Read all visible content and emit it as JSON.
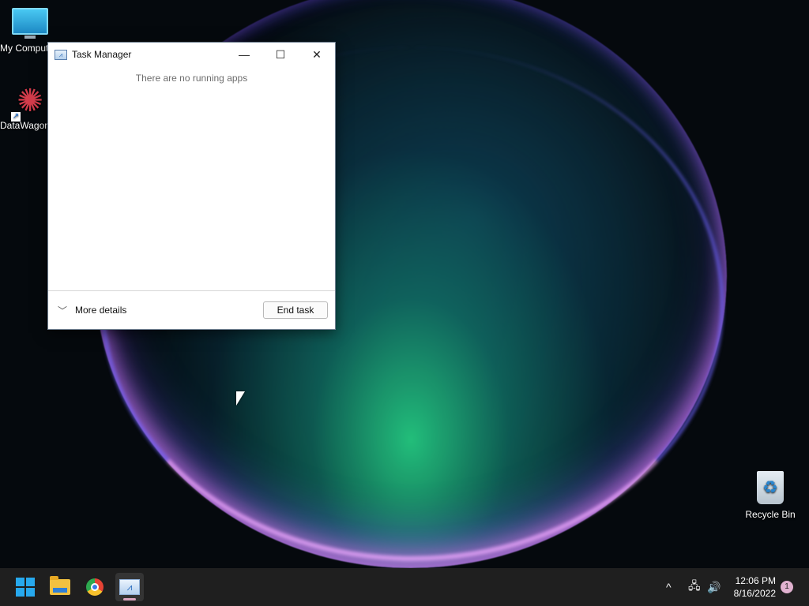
{
  "desktop": {
    "icons": [
      {
        "label": "My Computer",
        "icon": "monitor-icon"
      },
      {
        "label": "DataWagon",
        "icon": "datawagon-icon"
      },
      {
        "label": "Recycle Bin",
        "icon": "recycle-bin-icon"
      }
    ]
  },
  "task_manager": {
    "title": "Task Manager",
    "controls": {
      "minimize": "—",
      "maximize": "☐",
      "close": "✕"
    },
    "empty_message": "There are no running apps",
    "more_details_label": "More details",
    "end_task_label": "End task"
  },
  "taskbar": {
    "pinned": [
      {
        "name": "Start",
        "icon": "windows-start-icon"
      },
      {
        "name": "File Explorer",
        "icon": "folder-icon"
      },
      {
        "name": "Google Chrome",
        "icon": "chrome-icon"
      },
      {
        "name": "Task Manager",
        "icon": "task-manager-icon",
        "active": true
      }
    ],
    "tray": {
      "show_hidden": "^",
      "network": "🖧",
      "volume": "🔊"
    },
    "clock": {
      "time": "12:06 PM",
      "date": "8/16/2022"
    },
    "notification_count": "1"
  }
}
